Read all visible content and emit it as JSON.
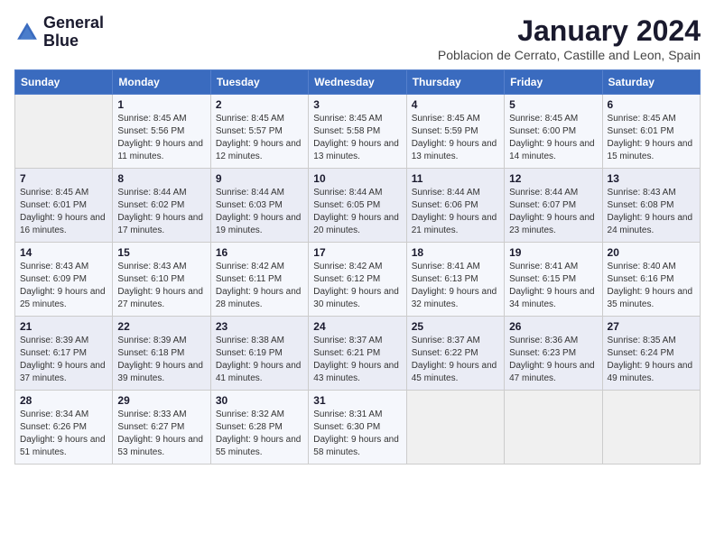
{
  "header": {
    "logo_line1": "General",
    "logo_line2": "Blue",
    "month": "January 2024",
    "location": "Poblacion de Cerrato, Castille and Leon, Spain"
  },
  "weekdays": [
    "Sunday",
    "Monday",
    "Tuesday",
    "Wednesday",
    "Thursday",
    "Friday",
    "Saturday"
  ],
  "weeks": [
    [
      {
        "day": "",
        "sunrise": "",
        "sunset": "",
        "daylight": ""
      },
      {
        "day": "1",
        "sunrise": "Sunrise: 8:45 AM",
        "sunset": "Sunset: 5:56 PM",
        "daylight": "Daylight: 9 hours and 11 minutes."
      },
      {
        "day": "2",
        "sunrise": "Sunrise: 8:45 AM",
        "sunset": "Sunset: 5:57 PM",
        "daylight": "Daylight: 9 hours and 12 minutes."
      },
      {
        "day": "3",
        "sunrise": "Sunrise: 8:45 AM",
        "sunset": "Sunset: 5:58 PM",
        "daylight": "Daylight: 9 hours and 13 minutes."
      },
      {
        "day": "4",
        "sunrise": "Sunrise: 8:45 AM",
        "sunset": "Sunset: 5:59 PM",
        "daylight": "Daylight: 9 hours and 13 minutes."
      },
      {
        "day": "5",
        "sunrise": "Sunrise: 8:45 AM",
        "sunset": "Sunset: 6:00 PM",
        "daylight": "Daylight: 9 hours and 14 minutes."
      },
      {
        "day": "6",
        "sunrise": "Sunrise: 8:45 AM",
        "sunset": "Sunset: 6:01 PM",
        "daylight": "Daylight: 9 hours and 15 minutes."
      }
    ],
    [
      {
        "day": "7",
        "sunrise": "Sunrise: 8:45 AM",
        "sunset": "Sunset: 6:01 PM",
        "daylight": "Daylight: 9 hours and 16 minutes."
      },
      {
        "day": "8",
        "sunrise": "Sunrise: 8:44 AM",
        "sunset": "Sunset: 6:02 PM",
        "daylight": "Daylight: 9 hours and 17 minutes."
      },
      {
        "day": "9",
        "sunrise": "Sunrise: 8:44 AM",
        "sunset": "Sunset: 6:03 PM",
        "daylight": "Daylight: 9 hours and 19 minutes."
      },
      {
        "day": "10",
        "sunrise": "Sunrise: 8:44 AM",
        "sunset": "Sunset: 6:05 PM",
        "daylight": "Daylight: 9 hours and 20 minutes."
      },
      {
        "day": "11",
        "sunrise": "Sunrise: 8:44 AM",
        "sunset": "Sunset: 6:06 PM",
        "daylight": "Daylight: 9 hours and 21 minutes."
      },
      {
        "day": "12",
        "sunrise": "Sunrise: 8:44 AM",
        "sunset": "Sunset: 6:07 PM",
        "daylight": "Daylight: 9 hours and 23 minutes."
      },
      {
        "day": "13",
        "sunrise": "Sunrise: 8:43 AM",
        "sunset": "Sunset: 6:08 PM",
        "daylight": "Daylight: 9 hours and 24 minutes."
      }
    ],
    [
      {
        "day": "14",
        "sunrise": "Sunrise: 8:43 AM",
        "sunset": "Sunset: 6:09 PM",
        "daylight": "Daylight: 9 hours and 25 minutes."
      },
      {
        "day": "15",
        "sunrise": "Sunrise: 8:43 AM",
        "sunset": "Sunset: 6:10 PM",
        "daylight": "Daylight: 9 hours and 27 minutes."
      },
      {
        "day": "16",
        "sunrise": "Sunrise: 8:42 AM",
        "sunset": "Sunset: 6:11 PM",
        "daylight": "Daylight: 9 hours and 28 minutes."
      },
      {
        "day": "17",
        "sunrise": "Sunrise: 8:42 AM",
        "sunset": "Sunset: 6:12 PM",
        "daylight": "Daylight: 9 hours and 30 minutes."
      },
      {
        "day": "18",
        "sunrise": "Sunrise: 8:41 AM",
        "sunset": "Sunset: 6:13 PM",
        "daylight": "Daylight: 9 hours and 32 minutes."
      },
      {
        "day": "19",
        "sunrise": "Sunrise: 8:41 AM",
        "sunset": "Sunset: 6:15 PM",
        "daylight": "Daylight: 9 hours and 34 minutes."
      },
      {
        "day": "20",
        "sunrise": "Sunrise: 8:40 AM",
        "sunset": "Sunset: 6:16 PM",
        "daylight": "Daylight: 9 hours and 35 minutes."
      }
    ],
    [
      {
        "day": "21",
        "sunrise": "Sunrise: 8:39 AM",
        "sunset": "Sunset: 6:17 PM",
        "daylight": "Daylight: 9 hours and 37 minutes."
      },
      {
        "day": "22",
        "sunrise": "Sunrise: 8:39 AM",
        "sunset": "Sunset: 6:18 PM",
        "daylight": "Daylight: 9 hours and 39 minutes."
      },
      {
        "day": "23",
        "sunrise": "Sunrise: 8:38 AM",
        "sunset": "Sunset: 6:19 PM",
        "daylight": "Daylight: 9 hours and 41 minutes."
      },
      {
        "day": "24",
        "sunrise": "Sunrise: 8:37 AM",
        "sunset": "Sunset: 6:21 PM",
        "daylight": "Daylight: 9 hours and 43 minutes."
      },
      {
        "day": "25",
        "sunrise": "Sunrise: 8:37 AM",
        "sunset": "Sunset: 6:22 PM",
        "daylight": "Daylight: 9 hours and 45 minutes."
      },
      {
        "day": "26",
        "sunrise": "Sunrise: 8:36 AM",
        "sunset": "Sunset: 6:23 PM",
        "daylight": "Daylight: 9 hours and 47 minutes."
      },
      {
        "day": "27",
        "sunrise": "Sunrise: 8:35 AM",
        "sunset": "Sunset: 6:24 PM",
        "daylight": "Daylight: 9 hours and 49 minutes."
      }
    ],
    [
      {
        "day": "28",
        "sunrise": "Sunrise: 8:34 AM",
        "sunset": "Sunset: 6:26 PM",
        "daylight": "Daylight: 9 hours and 51 minutes."
      },
      {
        "day": "29",
        "sunrise": "Sunrise: 8:33 AM",
        "sunset": "Sunset: 6:27 PM",
        "daylight": "Daylight: 9 hours and 53 minutes."
      },
      {
        "day": "30",
        "sunrise": "Sunrise: 8:32 AM",
        "sunset": "Sunset: 6:28 PM",
        "daylight": "Daylight: 9 hours and 55 minutes."
      },
      {
        "day": "31",
        "sunrise": "Sunrise: 8:31 AM",
        "sunset": "Sunset: 6:30 PM",
        "daylight": "Daylight: 9 hours and 58 minutes."
      },
      {
        "day": "",
        "sunrise": "",
        "sunset": "",
        "daylight": ""
      },
      {
        "day": "",
        "sunrise": "",
        "sunset": "",
        "daylight": ""
      },
      {
        "day": "",
        "sunrise": "",
        "sunset": "",
        "daylight": ""
      }
    ]
  ]
}
